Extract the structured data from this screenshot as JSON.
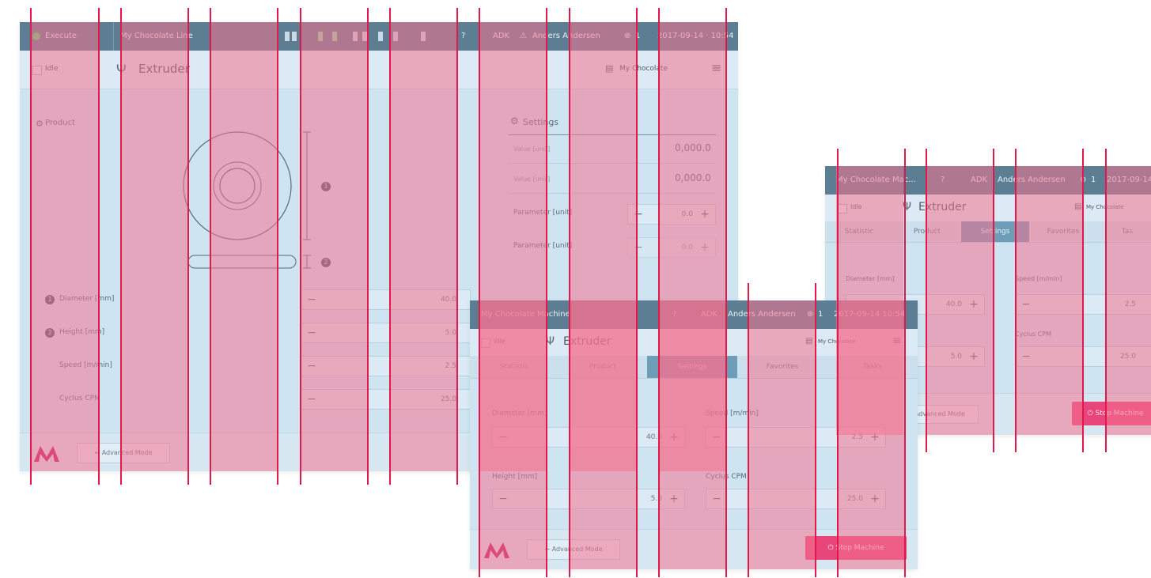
{
  "screen_main": {
    "topbar": {
      "status_text": "Execute",
      "line_name": "My Chocolate Line",
      "language": "ADK",
      "user": "Anders Andersen",
      "alerts": "1",
      "datetime": "2017-09-14 · 10:54"
    },
    "subbar": {
      "idle_label": "Idle",
      "module_title": "Extruder",
      "recipe": "My Chocolate",
      "menu_icon": "hamburger-icon"
    },
    "product_label": "Product",
    "settings_title": "Settings",
    "settings_rows": [
      {
        "label": "Value [unit]",
        "value": "0,000.0"
      },
      {
        "label": "Value [unit]",
        "value": "0,000.0"
      },
      {
        "label": "Parameter [unit]",
        "value": "0.0"
      },
      {
        "label": "Parameter [unit]",
        "value": "0.0"
      }
    ],
    "badges": [
      "1",
      "2"
    ],
    "params": [
      {
        "badge": "1",
        "label": "Diameter [mm]",
        "value": "40.0"
      },
      {
        "badge": "2",
        "label": "Height [mm]",
        "value": "5.0"
      },
      {
        "badge": "",
        "label": "Speed [m/min]",
        "value": "2.5"
      },
      {
        "badge": "",
        "label": "Cyclus CPM",
        "value": "25.0"
      }
    ],
    "footer": {
      "advanced_label": "Advanced Mode"
    }
  },
  "screen_front": {
    "topbar": {
      "machine": "My Chocolate Machine",
      "help": "?",
      "language": "ADK",
      "user": "Anders Andersen",
      "alerts": "1",
      "datetime": "2017-09-14 10:54"
    },
    "subbar": {
      "idle_label": "Idle",
      "module_title": "Extruder",
      "recipe": "My Chocolate",
      "menu_icon": "hamburger-icon"
    },
    "tabs": [
      "Statistic",
      "Product",
      "Settings",
      "Favorites",
      "Tasks"
    ],
    "active_tab": "Settings",
    "fields": [
      {
        "label": "Diameter [mm]",
        "value": "40.0"
      },
      {
        "label": "Speed [m/min]",
        "value": "2.5"
      },
      {
        "label": "Height [mm]",
        "value": "5.0"
      },
      {
        "label": "Cyclus CPM",
        "value": "25.0"
      }
    ],
    "footer": {
      "advanced_label": "Advanced Mode",
      "stop_label": "Stop Machine"
    }
  },
  "screen_right": {
    "topbar": {
      "machine": "My Chocolate Mac...",
      "help": "?",
      "language": "ADK",
      "user": "Anders Andersen",
      "alerts": "1",
      "datetime": "2017-09-14"
    },
    "subbar": {
      "idle_label": "Idle",
      "module_title": "Extruder",
      "recipe": "My Chocolate"
    },
    "tabs": [
      "Statistic",
      "Product",
      "Settings",
      "Favorites",
      "Tas"
    ],
    "active_tab": "Settings",
    "fields": [
      {
        "label": "Diameter [mm]",
        "value": "40.0"
      },
      {
        "label": "Speed [m/min]",
        "value": "2.5"
      },
      {
        "label": "",
        "value": "5.0"
      },
      {
        "label": "Cyclus CPM",
        "value": "25.0"
      }
    ],
    "footer": {
      "advanced_label": "Advanced Mode",
      "stop_label": "Stop Machine"
    }
  },
  "colors": {
    "topbar": "#5d7d92",
    "screen_bg": "#cfe4f1",
    "overlay_band": "#f47290",
    "guide_line": "#e0194a",
    "stop_button": "#e8457a",
    "logo": "#c2185b"
  }
}
